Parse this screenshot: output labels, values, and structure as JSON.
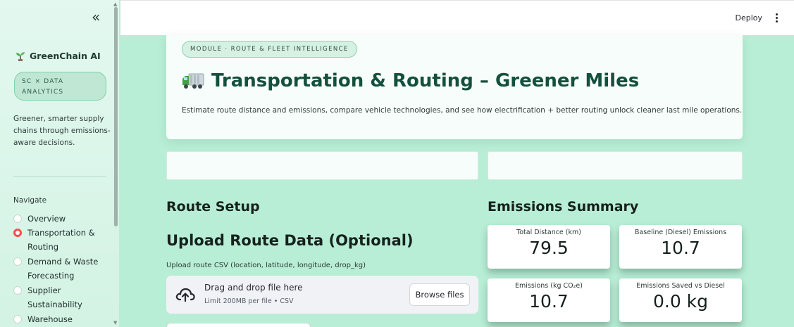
{
  "sidebar": {
    "brand": "GreenChain AI",
    "badge": "SC × DATA ANALYTICS",
    "tagline": "Greener, smarter supply chains through emissions-aware decisions.",
    "nav_label": "Navigate",
    "items": [
      {
        "label": "Overview",
        "selected": false
      },
      {
        "label": "Transportation & Routing",
        "selected": true
      },
      {
        "label": "Demand & Waste Forecasting",
        "selected": false
      },
      {
        "label": "Supplier Sustainability",
        "selected": false
      },
      {
        "label": "Warehouse",
        "selected": false
      }
    ]
  },
  "header": {
    "deploy_label": "Deploy"
  },
  "hero": {
    "module": "MODULE · ROUTE & FLEET INTELLIGENCE",
    "title": "Transportation & Routing – Greener Miles",
    "description": "Estimate route distance and emissions, compare vehicle technologies, and see how electrification + better routing unlock cleaner last mile operations."
  },
  "route_setup": {
    "heading": "Route Setup",
    "upload_heading": "Upload Route Data (Optional)",
    "upload_label": "Upload route CSV (location, latitude, longitude, drop_kg)",
    "dropzone_title": "Drag and drop file here",
    "dropzone_sub": "Limit 200MB per file • CSV",
    "browse_label": "Browse files"
  },
  "emissions": {
    "heading": "Emissions Summary",
    "metrics": [
      {
        "label": "Total Distance (km)",
        "value": "79.5"
      },
      {
        "label": "Baseline (Diesel) Emissions",
        "value": "10.7"
      },
      {
        "label": "Emissions (kg CO₂e)",
        "value": "10.7"
      },
      {
        "label": "Emissions Saved vs Diesel",
        "value": "0.0 kg"
      }
    ]
  },
  "colors": {
    "accent": "#14503d",
    "background": "#b8eed6",
    "radio_selected": "#ff4b4b"
  }
}
